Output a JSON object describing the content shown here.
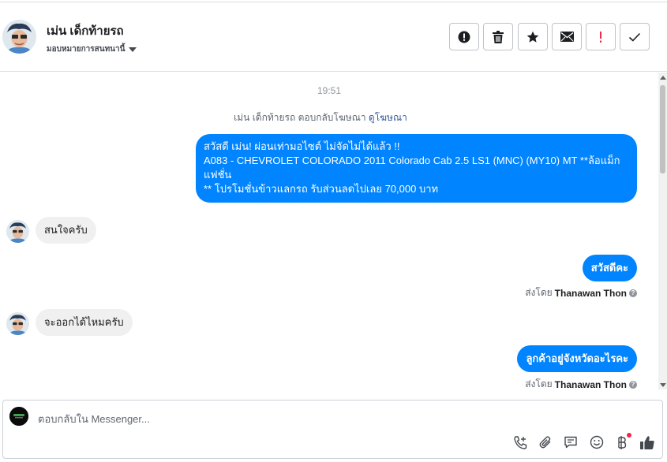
{
  "header": {
    "contact_name": "เม่น เด็กท้ายรถ",
    "assign_label": "มอบหมายการสนทนานี้",
    "actions": [
      {
        "icon": "alert-circle-icon",
        "color": "#1c1e21"
      },
      {
        "icon": "trash-icon",
        "color": "#1c1e21"
      },
      {
        "icon": "star-icon",
        "color": "#1c1e21"
      },
      {
        "icon": "envelope-icon",
        "color": "#1c1e21"
      },
      {
        "icon": "exclamation-icon",
        "color": "#f02849"
      },
      {
        "icon": "checkmark-icon",
        "color": "#1c1e21"
      }
    ]
  },
  "thread": {
    "timestamp": "19:51",
    "ad_reply": {
      "prefix": "เม่น เด็กท้ายรถ ตอบกลับโฆษณา",
      "link": "ดูโฆษณา"
    },
    "messages": [
      {
        "direction": "out",
        "lines": [
          "สวัสดี เม่น! ผ่อนเท่ามอไซต์ ไม่จัดไม่ได้แล้ว !!",
          "A083 - CHEVROLET COLORADO 2011 Colorado Cab 2.5 LS1 (MNC) (MY10) MT **ล้อแม็กแฟชั่น",
          "** โปรโมชั่นข้าวแลกรถ รับส่วนลดไปเลย 70,000 บาท"
        ]
      },
      {
        "direction": "in",
        "text": "สนใจครับ"
      },
      {
        "direction": "out",
        "text": "สวัสดีคะ"
      },
      {
        "direction": "in",
        "text": "จะออกได้ไหมครับ"
      },
      {
        "direction": "out",
        "text": "ลูกค้าอยู่จังหวัดอะไรคะ"
      }
    ],
    "sent_by": {
      "prefix": "ส่งโดย",
      "agent": "Thanawan Thon"
    }
  },
  "composer": {
    "placeholder": "ตอบกลับใน Messenger...",
    "icons": [
      "phone-plus-icon",
      "paperclip-icon",
      "chat-bubble-icon",
      "emoji-icon",
      "baht-icon",
      "thumbs-up-icon"
    ],
    "accent": "#0084ff"
  }
}
